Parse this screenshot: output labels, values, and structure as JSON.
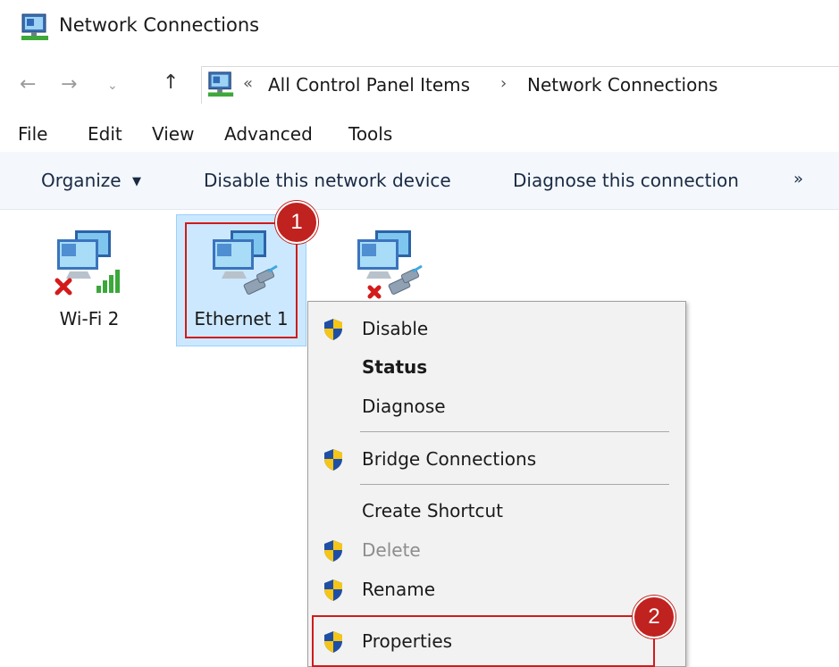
{
  "window": {
    "title": "Network Connections",
    "title_icon": "network-connections-icon"
  },
  "navigation": {
    "back_icon": "back-arrow-icon",
    "forward_icon": "forward-arrow-icon",
    "recent_icon": "chevron-down-icon",
    "up_icon": "up-arrow-icon",
    "overflow": "«",
    "breadcrumbs": [
      "All Control Panel Items",
      "Network Connections"
    ],
    "separator": "›"
  },
  "menubar": [
    "File",
    "Edit",
    "View",
    "Advanced",
    "Tools"
  ],
  "command_bar": {
    "organize": "Organize",
    "disable": "Disable this network device",
    "diagnose": "Diagnose this connection",
    "more": "»"
  },
  "connections": [
    {
      "label": "Wi-Fi 2",
      "icon": "wifi-adapter-icon",
      "status": "disconnected",
      "selected": false
    },
    {
      "label": "Ethernet 1",
      "icon": "ethernet-adapter-icon",
      "status": "connected",
      "selected": true
    },
    {
      "label": "",
      "icon": "ethernet-adapter-icon",
      "status": "disconnected",
      "selected": false
    }
  ],
  "context_menu": {
    "items": [
      {
        "label": "Disable",
        "shield": true,
        "bold": false,
        "disabled": false
      },
      {
        "label": "Status",
        "shield": false,
        "bold": true,
        "disabled": false
      },
      {
        "label": "Diagnose",
        "shield": false,
        "bold": false,
        "disabled": false
      },
      {
        "label": "Bridge Connections",
        "shield": true,
        "bold": false,
        "disabled": false
      },
      {
        "label": "Create Shortcut",
        "shield": false,
        "bold": false,
        "disabled": false
      },
      {
        "label": "Delete",
        "shield": true,
        "bold": false,
        "disabled": true
      },
      {
        "label": "Rename",
        "shield": true,
        "bold": false,
        "disabled": false
      },
      {
        "label": "Properties",
        "shield": true,
        "bold": false,
        "disabled": false
      }
    ]
  },
  "annotations": {
    "step1": "1",
    "step2": "2",
    "color": "#c0221f"
  },
  "colors": {
    "selection": "#cce8ff",
    "command_bar": "#f4f8fc",
    "menu_bg": "#f2f2f2"
  }
}
